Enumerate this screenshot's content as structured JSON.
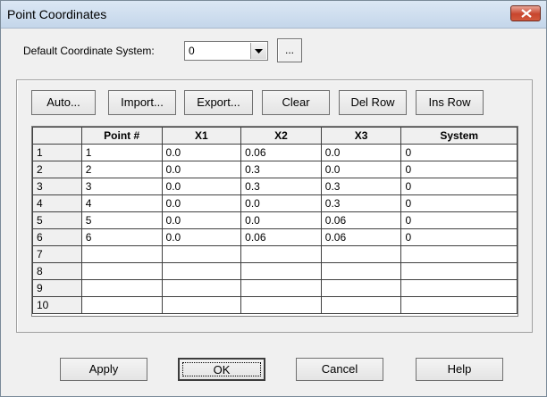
{
  "window": {
    "title": "Point Coordinates"
  },
  "default_cs": {
    "label": "Default Coordinate System:",
    "value": "0",
    "browse_label": "..."
  },
  "toolbar": {
    "auto": "Auto...",
    "import": "Import...",
    "export": "Export...",
    "clear": "Clear",
    "del_row": "Del Row",
    "ins_row": "Ins Row"
  },
  "table": {
    "columns": [
      "",
      "Point #",
      "X1",
      "X2",
      "X3",
      "System"
    ],
    "rows": [
      [
        "1",
        "1",
        "0.0",
        "0.06",
        "0.0",
        "0"
      ],
      [
        "2",
        "2",
        "0.0",
        "0.3",
        "0.0",
        "0"
      ],
      [
        "3",
        "3",
        "0.0",
        "0.3",
        "0.3",
        "0"
      ],
      [
        "4",
        "4",
        "0.0",
        "0.0",
        "0.3",
        "0"
      ],
      [
        "5",
        "5",
        "0.0",
        "0.0",
        "0.06",
        "0"
      ],
      [
        "6",
        "6",
        "0.0",
        "0.06",
        "0.06",
        "0"
      ],
      [
        "7",
        "",
        "",
        "",
        "",
        ""
      ],
      [
        "8",
        "",
        "",
        "",
        "",
        ""
      ],
      [
        "9",
        "",
        "",
        "",
        "",
        ""
      ],
      [
        "10",
        "",
        "",
        "",
        "",
        ""
      ]
    ]
  },
  "footer": {
    "apply": "Apply",
    "ok": "OK",
    "cancel": "Cancel",
    "help": "Help"
  }
}
